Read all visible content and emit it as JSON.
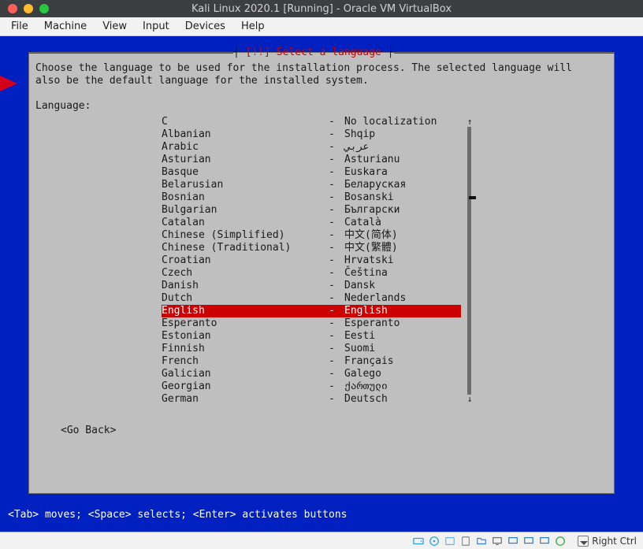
{
  "window": {
    "title": "Kali Linux 2020.1 [Running] - Oracle VM VirtualBox"
  },
  "menubar": {
    "items": [
      "File",
      "Machine",
      "View",
      "Input",
      "Devices",
      "Help"
    ]
  },
  "installer": {
    "title_tag": "[!!]",
    "title_text": "Select a language",
    "description": "Choose the language to be used for the installation process. The selected language will\nalso be the default language for the installed system.",
    "field_label": "Language:",
    "go_back": "<Go Back>",
    "hint": "<Tab> moves; <Space> selects; <Enter> activates buttons",
    "scroll": {
      "up": "↑",
      "down": "↓"
    },
    "selected_index": 15,
    "languages": [
      {
        "name": "C",
        "sep": "-",
        "native": "No localization"
      },
      {
        "name": "Albanian",
        "sep": "-",
        "native": "Shqip"
      },
      {
        "name": "Arabic",
        "sep": "-",
        "native": "عربي"
      },
      {
        "name": "Asturian",
        "sep": "-",
        "native": "Asturianu"
      },
      {
        "name": "Basque",
        "sep": "-",
        "native": "Euskara"
      },
      {
        "name": "Belarusian",
        "sep": "-",
        "native": "Беларуская"
      },
      {
        "name": "Bosnian",
        "sep": "-",
        "native": "Bosanski"
      },
      {
        "name": "Bulgarian",
        "sep": "-",
        "native": "Български"
      },
      {
        "name": "Catalan",
        "sep": "-",
        "native": "Català"
      },
      {
        "name": "Chinese (Simplified)",
        "sep": "-",
        "native": "中文(简体)"
      },
      {
        "name": "Chinese (Traditional)",
        "sep": "-",
        "native": "中文(繁體)"
      },
      {
        "name": "Croatian",
        "sep": "-",
        "native": "Hrvatski"
      },
      {
        "name": "Czech",
        "sep": "-",
        "native": "Čeština"
      },
      {
        "name": "Danish",
        "sep": "-",
        "native": "Dansk"
      },
      {
        "name": "Dutch",
        "sep": "-",
        "native": "Nederlands"
      },
      {
        "name": "English",
        "sep": "-",
        "native": "English"
      },
      {
        "name": "Esperanto",
        "sep": "-",
        "native": "Esperanto"
      },
      {
        "name": "Estonian",
        "sep": "-",
        "native": "Eesti"
      },
      {
        "name": "Finnish",
        "sep": "-",
        "native": "Suomi"
      },
      {
        "name": "French",
        "sep": "-",
        "native": "Français"
      },
      {
        "name": "Galician",
        "sep": "-",
        "native": "Galego"
      },
      {
        "name": "Georgian",
        "sep": "-",
        "native": "ქართული"
      },
      {
        "name": "German",
        "sep": "-",
        "native": "Deutsch"
      }
    ]
  },
  "statusbar": {
    "icons": [
      "hard-disk-icon",
      "optical-disc-icon",
      "audio-icon",
      "usb-icon",
      "shared-folders-icon",
      "display-icon",
      "recording-icon",
      "monitor1-icon",
      "monitor2-icon",
      "network-icon"
    ],
    "host_key": "Right Ctrl"
  }
}
